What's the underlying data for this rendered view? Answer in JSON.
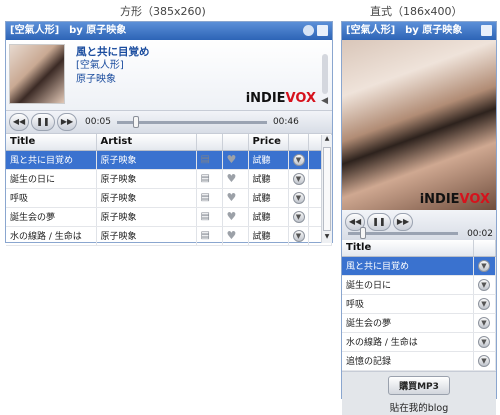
{
  "captions": {
    "square": "方形（385x260)",
    "vertical": "直式（186x400）"
  },
  "header": {
    "title": "[空氣人形]　by 原子映象"
  },
  "now_playing": {
    "song": "風と共に目覚め",
    "album": "[空氣人形]",
    "artist": "原子映象",
    "elapsed": "00:05",
    "remaining": "00:46",
    "vertical_remaining": "00:02",
    "progress": 0.11
  },
  "logo": {
    "main": "iNDIE",
    "accent": "VOX"
  },
  "icons": {
    "header": [
      "info-icon",
      "window-icon"
    ],
    "controls": [
      "rewind-icon",
      "pause-icon",
      "forward-icon"
    ]
  },
  "table": {
    "columns": [
      "Title",
      "Artist",
      "Price"
    ],
    "rows": [
      {
        "title": "風と共に目覚め",
        "artist": "原子映象",
        "price": "試聽"
      },
      {
        "title": "誕生の日に",
        "artist": "原子映象",
        "price": "試聽"
      },
      {
        "title": "呼吸",
        "artist": "原子映象",
        "price": "試聽"
      },
      {
        "title": "誕生会の夢",
        "artist": "原子映象",
        "price": "試聽"
      },
      {
        "title": "水の線路 / 生命は",
        "artist": "原子映象",
        "price": "試聽"
      }
    ]
  },
  "vertical": {
    "list_header": "Title",
    "items": [
      "風と共に目覚め",
      "誕生の日に",
      "呼吸",
      "誕生会の夢",
      "水の線路 / 生命は",
      "追憶の記録"
    ],
    "buy_label": "購買MP3",
    "blog_label": "貼在我的blog"
  },
  "colors": {
    "accent": "#3a72cf",
    "header": "#2d64b6",
    "vox_red": "#d6121c"
  }
}
